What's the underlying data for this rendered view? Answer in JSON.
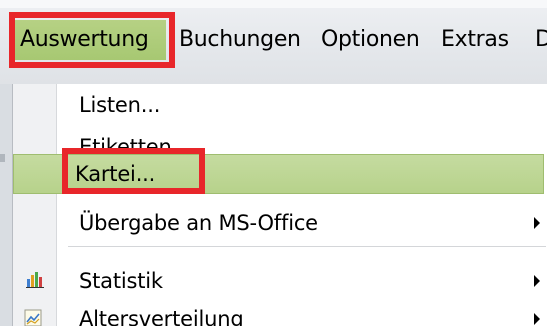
{
  "menubar": {
    "items": [
      {
        "label": "Auswertung"
      },
      {
        "label": "Buchungen"
      },
      {
        "label": "Optionen"
      },
      {
        "label": "Extras"
      },
      {
        "label": "D"
      }
    ],
    "active_color": "#a9c976"
  },
  "dropdown": {
    "items": [
      {
        "label": "Listen...",
        "submenu": false
      },
      {
        "label": "Etiketten...",
        "submenu": false
      },
      {
        "label": "Kartei...",
        "submenu": false,
        "hover": true
      },
      {
        "label": "Übergabe an MS-Office",
        "submenu": true
      },
      {
        "label": "Statistik",
        "submenu": true,
        "icon": "bar-chart-icon"
      },
      {
        "label": "Altersverteilung",
        "submenu": true,
        "icon": "age-chart-icon"
      }
    ],
    "hover_color": "#bfd798"
  },
  "annotations": {
    "highlight_color": "#e8262a"
  }
}
